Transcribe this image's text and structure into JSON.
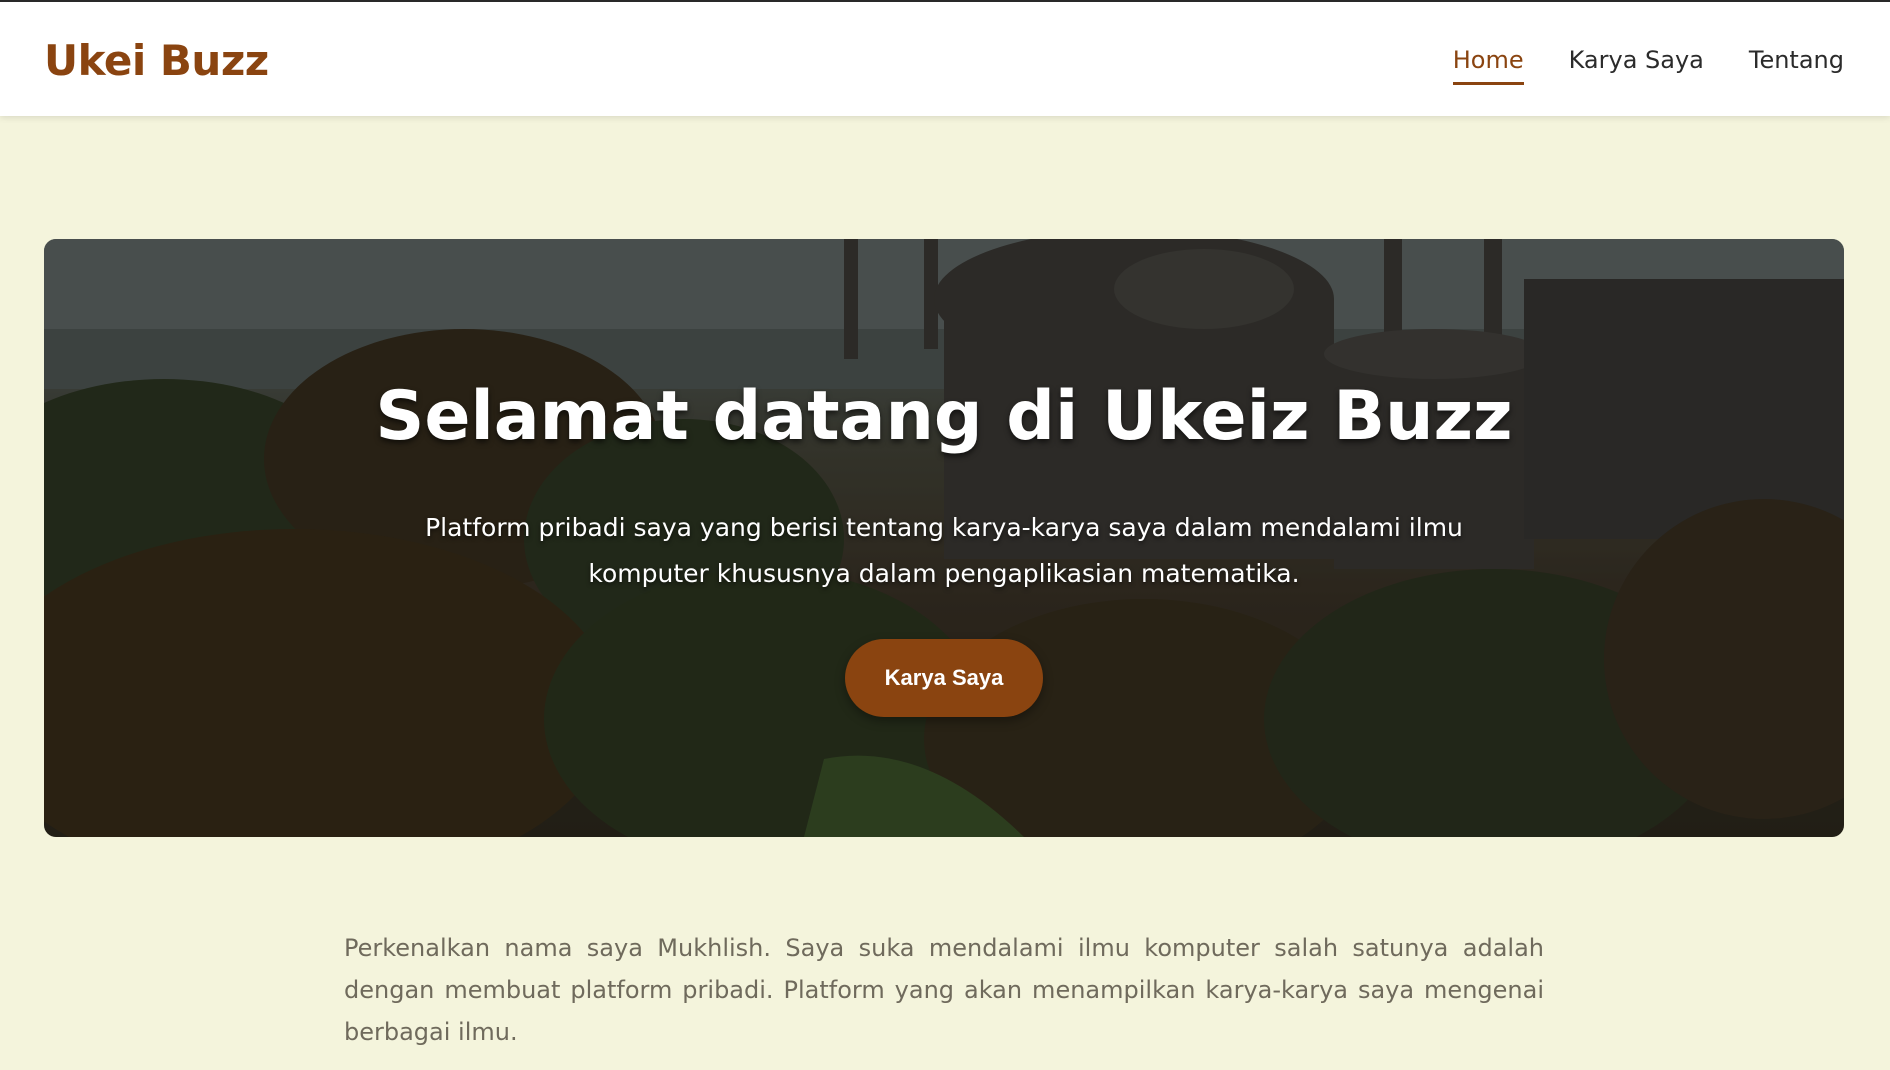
{
  "header": {
    "brand": "Ukei Buzz",
    "nav": [
      {
        "label": "Home",
        "active": true
      },
      {
        "label": "Karya Saya",
        "active": false
      },
      {
        "label": "Tentang",
        "active": false
      }
    ]
  },
  "hero": {
    "title": "Selamat datang di Ukeiz Buzz",
    "subtitle": "Platform pribadi saya yang berisi tentang karya-karya saya dalam mendalami ilmu komputer khususnya dalam pengaplikasian matematika.",
    "button_label": "Karya Saya"
  },
  "intro": {
    "text": "Perkenalkan nama saya Mukhlish. Saya suka mendalami ilmu komputer salah satunya adalah dengan membuat platform pribadi. Platform yang akan menampilkan karya-karya saya mengenai berbagai ilmu."
  },
  "colors": {
    "accent": "#8a4410",
    "page_background": "#f4f4dc",
    "header_background": "#ffffff"
  }
}
